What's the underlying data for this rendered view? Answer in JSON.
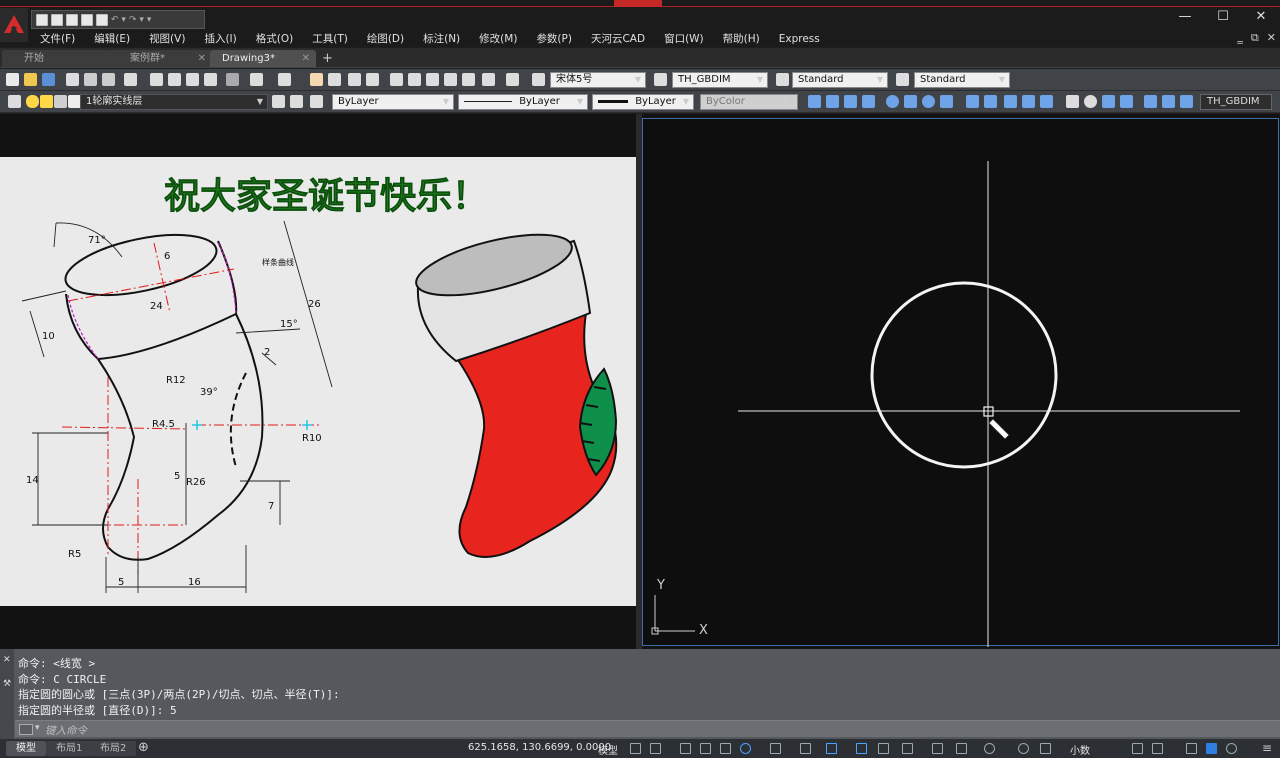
{
  "app": {
    "title": "AutoCAD",
    "menu": [
      "文件(F)",
      "编辑(E)",
      "视图(V)",
      "插入(I)",
      "格式(O)",
      "工具(T)",
      "绘图(D)",
      "标注(N)",
      "修改(M)",
      "参数(P)",
      "天河云CAD",
      "窗口(W)",
      "帮助(H)",
      "Express"
    ],
    "window_controls": [
      "—",
      "☐",
      "✕"
    ]
  },
  "file_tabs": [
    {
      "label": "开始",
      "active": false
    },
    {
      "label": "案例群*",
      "active": false
    },
    {
      "label": "Drawing3*",
      "active": true
    }
  ],
  "toolbar1": {
    "text_style_font": "宋体5号",
    "dim_style": "TH_GBDIM",
    "table_style": "Standard",
    "multileader_style": "Standard"
  },
  "toolbar2": {
    "layer": "1轮廓实线层",
    "color": "ByLayer",
    "linetype": "ByLayer",
    "lineweight": "ByLayer",
    "plotstyle": "ByColor",
    "dim_style_right": "TH_GBDIM"
  },
  "reference_image": {
    "greeting": "祝大家圣诞节快乐！",
    "dimension_labels": [
      "71°",
      "6",
      "样条曲线",
      "24",
      "26",
      "10",
      "15°",
      "2",
      "R12",
      "39°",
      "R4.5",
      "R10",
      "5",
      "R26",
      "14",
      "7",
      "R5",
      "5",
      "16"
    ]
  },
  "ucs": {
    "x_label": "X",
    "y_label": "Y"
  },
  "command_line": {
    "history": [
      "命令:  <线宽 >",
      "命令: C CIRCLE",
      "指定圆的圆心或 [三点(3P)/两点(2P)/切点、切点、半径(T)]:",
      "指定圆的半径或 [直径(D)]: 5"
    ],
    "placeholder": "键入命令"
  },
  "status_bar": {
    "layout_tabs": [
      "模型",
      "布局1",
      "布局2"
    ],
    "coordinates": "625.1658, 130.6699, 0.0000",
    "model_label": "模型",
    "units": "小数"
  },
  "colors": {
    "sock_red": "#e8241e",
    "sock_cuff": "#e4e4e4",
    "sock_opening": "#bdbdbd",
    "patch_green": "#0e8f4a",
    "greeting_green": "#1f7a1f"
  }
}
